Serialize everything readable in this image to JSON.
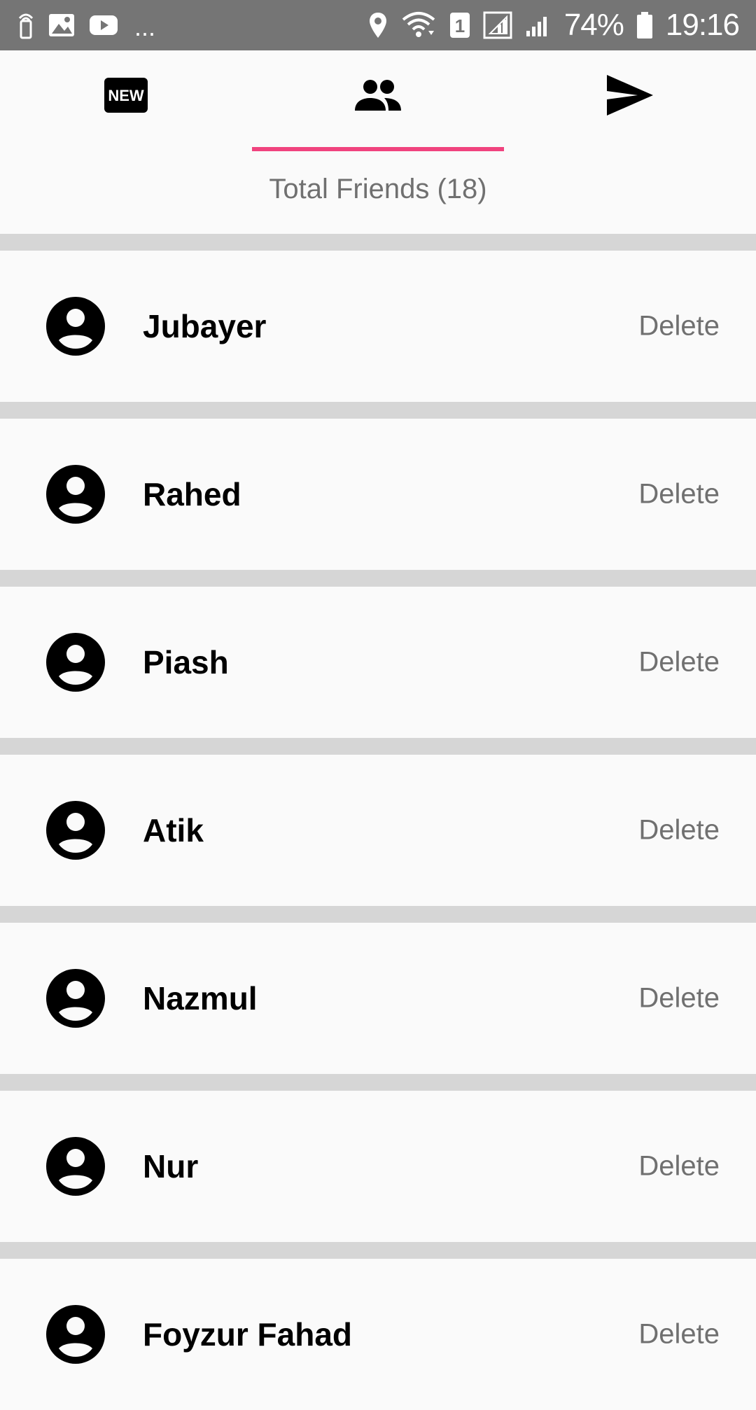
{
  "status_bar": {
    "battery_percent": "74%",
    "time": "19:16",
    "sim_badge": "1",
    "more_dots": "...",
    "left_icons": [
      "antenna-icon",
      "image-icon",
      "youtube-icon"
    ],
    "right_icons": [
      "location-icon",
      "wifi-icon",
      "sim-icon",
      "signal-icon",
      "signal-icon",
      "battery-icon"
    ]
  },
  "tabs": [
    {
      "icon": "new-badge-icon",
      "label_text": "NEW",
      "selected": false
    },
    {
      "icon": "people-icon",
      "selected": true
    },
    {
      "icon": "send-icon",
      "selected": false
    }
  ],
  "summary": {
    "total_friends": "Total Friends (18)"
  },
  "friends": [
    {
      "name": "Jubayer",
      "action": "Delete"
    },
    {
      "name": "Rahed",
      "action": "Delete"
    },
    {
      "name": "Piash",
      "action": "Delete"
    },
    {
      "name": "Atik",
      "action": "Delete"
    },
    {
      "name": "Nazmul",
      "action": "Delete"
    },
    {
      "name": "Nur",
      "action": "Delete"
    },
    {
      "name": "Foyzur Fahad",
      "action": "Delete"
    }
  ],
  "colors": {
    "status_bar": "#757575",
    "tab_indicator": "#f0437e",
    "background": "#fafafa",
    "separator": "#d6d6d6",
    "secondary_text": "#707070"
  }
}
